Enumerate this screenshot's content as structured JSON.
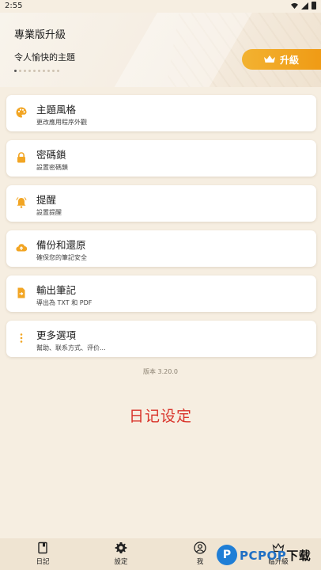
{
  "status_bar": {
    "time": "2:55"
  },
  "header": {
    "pro_title": "專業版升級",
    "pro_subtitle": "令人愉快的主題",
    "upgrade_label": "升級",
    "accent_color": "#f2a523"
  },
  "menu": [
    {
      "title": "主題風格",
      "desc": "更改應用程序外觀",
      "icon": "palette-icon"
    },
    {
      "title": "密碼鎖",
      "desc": "設置密碼鎖",
      "icon": "lock-icon"
    },
    {
      "title": "提醒",
      "desc": "設置提醒",
      "icon": "bell-icon"
    },
    {
      "title": "備份和還原",
      "desc": "確保您的筆記安全",
      "icon": "cloud-upload-icon"
    },
    {
      "title": "輸出筆記",
      "desc": "導出為 TXT 和 PDF",
      "icon": "file-export-icon"
    },
    {
      "title": "更多選項",
      "desc": "幫助、联系方式、评价...",
      "icon": "more-vertical-icon"
    }
  ],
  "version": "版本 3.20.0",
  "caption": "日记设定",
  "caption_color": "#d9342b",
  "bottom_nav": [
    {
      "label": "日記",
      "icon": "journal-icon"
    },
    {
      "label": "設定",
      "icon": "gear-icon"
    },
    {
      "label": "我",
      "icon": "user-icon"
    },
    {
      "label": "临升級",
      "icon": "crown-icon"
    }
  ],
  "watermark": {
    "logo_letter": "P",
    "brand": "PCPOP",
    "suffix": "下载"
  }
}
